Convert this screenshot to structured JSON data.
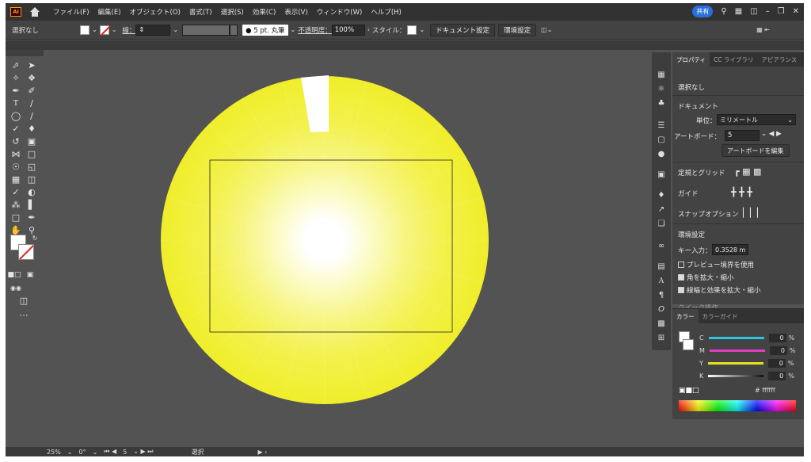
{
  "menubar": {
    "logo": "Ai",
    "items": [
      "ファイル(F)",
      "編集(E)",
      "オブジェクト(O)",
      "書式(T)",
      "選択(S)",
      "効果(C)",
      "表示(V)",
      "ウィンドウ(W)",
      "ヘルプ(H)"
    ],
    "share": "共有"
  },
  "control": {
    "selection": "選択なし",
    "stroke_label": "線：",
    "brush": "● 5 pt. 丸筆",
    "opacity_label": "不透明度：",
    "opacity_value": "100%",
    "style_label": "スタイル：",
    "doc_settings": "ドキュメント設定",
    "env_settings": "環境設定"
  },
  "properties": {
    "tabs": [
      "プロパティ",
      "CC ライブラリ",
      "アピアランス"
    ],
    "no_selection": "選択なし",
    "document": "ドキュメント",
    "unit_label": "単位：",
    "unit_value": "ミリメートル",
    "artboard_label": "アートボード：",
    "artboard_value": "5",
    "edit_artboard": "アートボードを編集",
    "rulers_grid": "定規とグリッド",
    "guides": "ガイド",
    "snap": "スナップオプション",
    "prefs": "環境設定",
    "key_input_label": "キー入力：",
    "key_input_value": "0.3528 m",
    "preview_bounds": "プレビュー境界を使用",
    "scale_corners": "角を拡大・縮小",
    "scale_strokes": "線幅と効果を拡大・縮小",
    "quick_actions": "クイック操作"
  },
  "color_panel": {
    "tabs": [
      "カラー",
      "カラーガイド"
    ],
    "channels": [
      {
        "name": "C",
        "value": "0",
        "unit": "%",
        "color": "#2ec4e0"
      },
      {
        "name": "M",
        "value": "0",
        "unit": "%",
        "color": "#e040c0"
      },
      {
        "name": "Y",
        "value": "0",
        "unit": "%",
        "color": "#e8e020"
      },
      {
        "name": "K",
        "value": "0",
        "unit": "%",
        "color": "#999999"
      }
    ],
    "hex": "ffffff"
  },
  "status": {
    "zoom": "25%",
    "rotation": "0°",
    "artboard": "5",
    "tool": "選択"
  },
  "artwork": {
    "outer_color": "#f0ee2a",
    "center_color": "#ffffff"
  }
}
